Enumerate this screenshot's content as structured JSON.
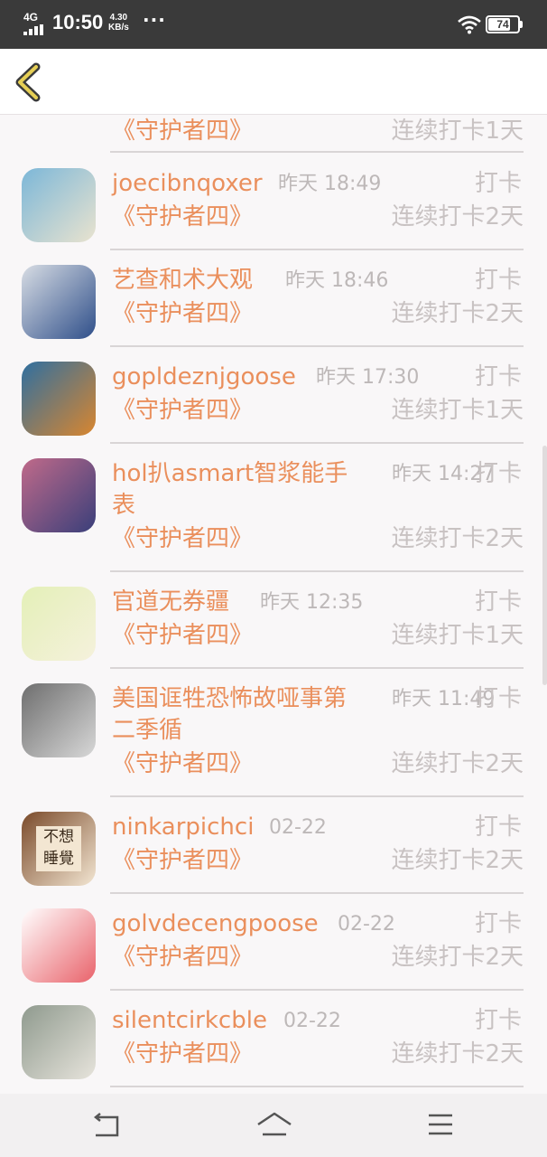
{
  "status_bar": {
    "network": "4G",
    "time": "10:50",
    "speed_value": "4.30",
    "speed_unit": "KB/s",
    "more": "···",
    "battery": "74"
  },
  "header": {
    "back_icon": "chevron-left-icon"
  },
  "partial_row": {
    "book": "《守护者四》",
    "streak": "连续打卡1天"
  },
  "entries": [
    {
      "name": "joecibnqoxer",
      "time": "昨天 18:49",
      "action": "打卡",
      "book": "《守护者四》",
      "streak": "连续打卡2天",
      "avatar_colors": [
        "#7cb7d8",
        "#e9e3cf"
      ]
    },
    {
      "name": "艺查和术大观",
      "time": "昨天 18:46",
      "action": "打卡",
      "book": "《守护者四》",
      "streak": "连续打卡2天",
      "avatar_colors": [
        "#d8dde4",
        "#2f4f8a"
      ]
    },
    {
      "name": "gopldeznjgoose",
      "time": "昨天 17:30",
      "action": "打卡",
      "book": "《守护者四》",
      "streak": "连续打卡1天",
      "avatar_colors": [
        "#2f6fa0",
        "#d9862f"
      ]
    },
    {
      "name": "hol扒asmart智浆能手表",
      "time": "昨天 14:27",
      "action": "打卡",
      "book": "《守护者四》",
      "streak": "连续打卡2天",
      "avatar_colors": [
        "#c06a8a",
        "#3a3f7a"
      ]
    },
    {
      "name": "官道无券疆",
      "time": "昨天 12:35",
      "action": "打卡",
      "book": "《守护者四》",
      "streak": "连续打卡1天",
      "avatar_colors": [
        "#e4f0b8",
        "#f5f1dc"
      ]
    },
    {
      "name": "美国诓牲恐怖故哑事第二季循",
      "time": "昨天 11:49",
      "action": "打卡",
      "book": "《守护者四》",
      "streak": "连续打卡2天",
      "avatar_colors": [
        "#6e6e6e",
        "#d8d8d8"
      ]
    },
    {
      "name": "ninkarpichci",
      "time": "02-22",
      "action": "打卡",
      "book": "《守护者四》",
      "streak": "连续打卡2天",
      "avatar_colors": [
        "#7a4a2a",
        "#f3e6d2"
      ],
      "avatar_text": "不想睡覺"
    },
    {
      "name": "golvdecengpoose",
      "time": "02-22",
      "action": "打卡",
      "book": "《守护者四》",
      "streak": "连续打卡2天",
      "avatar_colors": [
        "#ffffff",
        "#e9636b"
      ]
    },
    {
      "name": "silentcirkcble",
      "time": "02-22",
      "action": "打卡",
      "book": "《守护者四》",
      "streak": "连续打卡2天",
      "avatar_colors": [
        "#8f9a8e",
        "#e7e4dc"
      ]
    }
  ],
  "nav_bar": {
    "icons": [
      "back-icon",
      "home-icon",
      "menu-icon"
    ]
  }
}
